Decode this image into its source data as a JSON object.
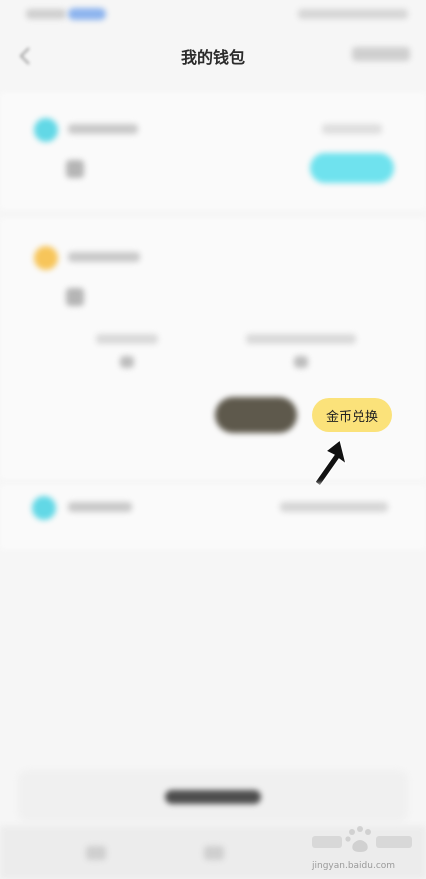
{
  "header": {
    "title": "我的钱包"
  },
  "exchange": {
    "label": "金币兑换"
  },
  "watermark": {
    "url": "jingyan.baidu.com"
  },
  "colors": {
    "exchange_button": "#fbe27a",
    "cyan_button": "#6fe2ee",
    "gold_icon": "#f7c55a",
    "cyan_icon": "#62d8e6",
    "dark_button": "#5e594c"
  },
  "icons": {
    "back": "back-arrow-icon",
    "pointer": "pointer-arrow-icon",
    "logo": "baidu-paw-logo"
  }
}
